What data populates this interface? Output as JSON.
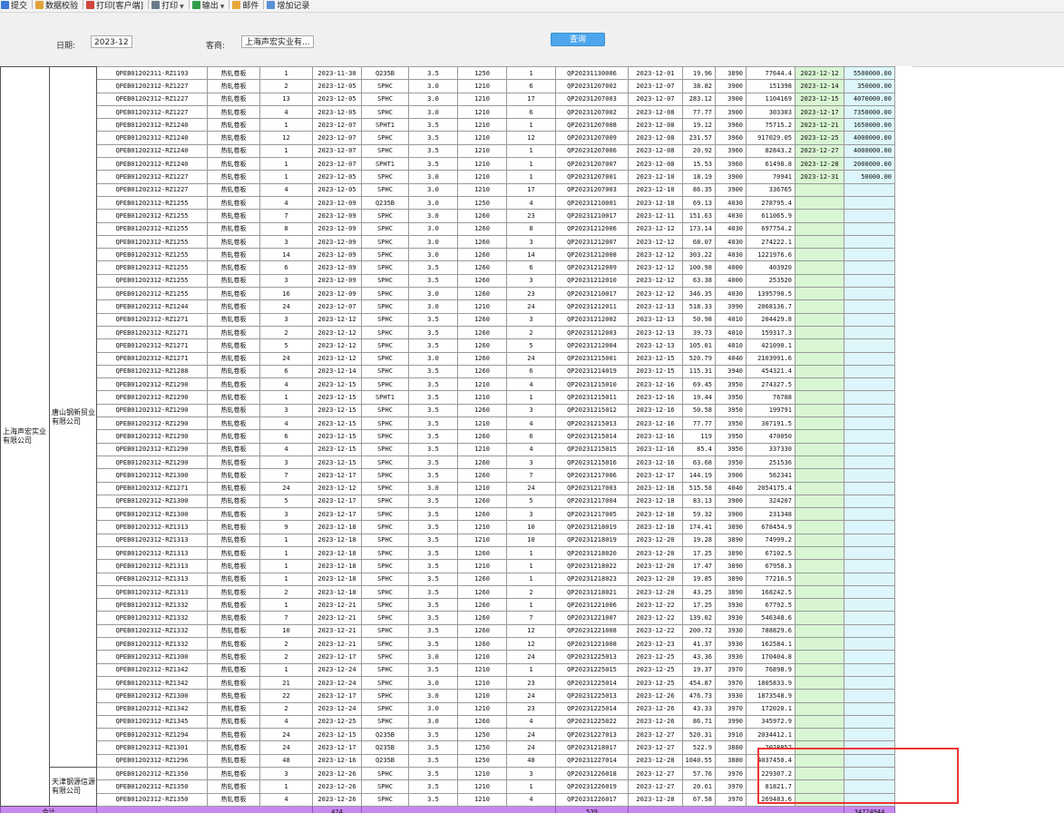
{
  "toolbar": {
    "items": [
      {
        "label": "提交",
        "icon": "submit-icon",
        "color": "#3a7ad6"
      },
      {
        "label": "数据校验",
        "icon": "validate-icon",
        "color": "#e2a33a"
      },
      {
        "label": "打印[客户端]",
        "icon": "print-client-icon",
        "color": "#d0453b"
      },
      {
        "label": "打印",
        "icon": "print-icon",
        "color": "#6b7a8a",
        "dropdown": true
      },
      {
        "label": "输出",
        "icon": "export-icon",
        "color": "#2f9e4a",
        "dropdown": true
      },
      {
        "label": "邮件",
        "icon": "mail-icon",
        "color": "#e6a73a"
      },
      {
        "label": "增加记录",
        "icon": "add-record-icon",
        "color": "#5a8fd6"
      }
    ]
  },
  "filter": {
    "date_label": "日期:",
    "date_value": "2023-12",
    "customer_label": "客商:",
    "customer_value": "上海声宏实业有...",
    "query_label": "查询"
  },
  "group": {
    "outer": "上海声宏实业有限公司",
    "inner1": "唐山钢新贸业有限公司",
    "inner2": "天津钢源信源有限公司"
  },
  "colors": {
    "green": "#d9f5d3",
    "blue": "#dcf6fb",
    "total": "#c987f1",
    "highlight": "#e33"
  },
  "rows": [
    [
      "QPEB01202311-RZ1193",
      "热轧卷板",
      "1",
      "2023-11-30",
      "Q235B",
      "3.5",
      "1250",
      "1",
      "QP20231130006",
      "2023-12-01",
      "19.96",
      "3890",
      "77644.4",
      "2023-12-12",
      "5500000.00"
    ],
    [
      "QPEB01202312-RZ1227",
      "热轧卷板",
      "2",
      "2023-12-05",
      "SPHC",
      "3.0",
      "1210",
      "6",
      "QP20231207002",
      "2023-12-07",
      "38.82",
      "3900",
      "151398",
      "2023-12-14",
      "350000.00"
    ],
    [
      "QPEB01202312-RZ1227",
      "热轧卷板",
      "13",
      "2023-12-05",
      "SPHC",
      "3.0",
      "1210",
      "17",
      "QP20231207003",
      "2023-12-07",
      "283.12",
      "3900",
      "1104169",
      "2023-12-15",
      "4070000.00"
    ],
    [
      "QPEB01202312-RZ1227",
      "热轧卷板",
      "4",
      "2023-12-05",
      "SPHC",
      "3.0",
      "1210",
      "6",
      "QP20231207002",
      "2023-12-08",
      "77.77",
      "3900",
      "303303",
      "2023-12-17",
      "7350000.00"
    ],
    [
      "QPEB01202312-RZ1240",
      "热轧卷板",
      "1",
      "2023-12-07",
      "SPHT1",
      "3.5",
      "1210",
      "1",
      "QP20231207008",
      "2023-12-08",
      "19.12",
      "3960",
      "75715.2",
      "2023-12-21",
      "1650000.00"
    ],
    [
      "QPEB01202312-RZ1240",
      "热轧卷板",
      "12",
      "2023-12-07",
      "SPHC",
      "3.5",
      "1210",
      "12",
      "QP20231207009",
      "2023-12-08",
      "231.57",
      "3960",
      "917029.05",
      "2023-12-25",
      "4000000.00"
    ],
    [
      "QPEB01202312-RZ1240",
      "热轧卷板",
      "1",
      "2023-12-07",
      "SPHC",
      "3.5",
      "1210",
      "1",
      "QP20231207006",
      "2023-12-08",
      "20.92",
      "3960",
      "82843.2",
      "2023-12-27",
      "4000000.00"
    ],
    [
      "QPEB01202312-RZ1240",
      "热轧卷板",
      "1",
      "2023-12-07",
      "SPHT1",
      "3.5",
      "1210",
      "1",
      "QP20231207007",
      "2023-12-08",
      "15.53",
      "3960",
      "61498.8",
      "2023-12-28",
      "2000000.00"
    ],
    [
      "QPEB01202312-RZ1227",
      "热轧卷板",
      "1",
      "2023-12-05",
      "SPHC",
      "3.0",
      "1210",
      "1",
      "QP20231207001",
      "2023-12-10",
      "18.19",
      "3900",
      "70941",
      "2023-12-31",
      "50000.00"
    ],
    [
      "QPEB01202312-RZ1227",
      "热轧卷板",
      "4",
      "2023-12-05",
      "SPHC",
      "3.0",
      "1210",
      "17",
      "QP20231207003",
      "2023-12-10",
      "86.35",
      "3900",
      "336765",
      "",
      ""
    ],
    [
      "QPEB01202312-RZ1255",
      "热轧卷板",
      "4",
      "2023-12-09",
      "Q235B",
      "3.0",
      "1250",
      "4",
      "QP20231210001",
      "2023-12-10",
      "69.13",
      "4030",
      "278795.4",
      "",
      ""
    ],
    [
      "QPEB01202312-RZ1255",
      "热轧卷板",
      "7",
      "2023-12-09",
      "SPHC",
      "3.0",
      "1260",
      "23",
      "QP20231210017",
      "2023-12-11",
      "151.63",
      "4030",
      "611065.9",
      "",
      ""
    ],
    [
      "QPEB01202312-RZ1255",
      "热轧卷板",
      "8",
      "2023-12-09",
      "SPHC",
      "3.0",
      "1260",
      "8",
      "QP20231212006",
      "2023-12-12",
      "173.14",
      "4030",
      "697754.2",
      "",
      ""
    ],
    [
      "QPEB01202312-RZ1255",
      "热轧卷板",
      "3",
      "2023-12-09",
      "SPHC",
      "3.0",
      "1260",
      "3",
      "QP20231212007",
      "2023-12-12",
      "68.07",
      "4030",
      "274222.1",
      "",
      ""
    ],
    [
      "QPEB01202312-RZ1255",
      "热轧卷板",
      "14",
      "2023-12-09",
      "SPHC",
      "3.0",
      "1260",
      "14",
      "QP20231212008",
      "2023-12-12",
      "303.22",
      "4030",
      "1221976.6",
      "",
      ""
    ],
    [
      "QPEB01202312-RZ1255",
      "热轧卷板",
      "6",
      "2023-12-09",
      "SPHC",
      "3.5",
      "1260",
      "6",
      "QP20231212009",
      "2023-12-12",
      "100.98",
      "4000",
      "403920",
      "",
      ""
    ],
    [
      "QPEB01202312-RZ1255",
      "热轧卷板",
      "3",
      "2023-12-09",
      "SPHC",
      "3.5",
      "1260",
      "3",
      "QP20231212010",
      "2023-12-12",
      "63.38",
      "4000",
      "253520",
      "",
      ""
    ],
    [
      "QPEB01202312-RZ1255",
      "热轧卷板",
      "16",
      "2023-12-09",
      "SPHC",
      "3.0",
      "1260",
      "23",
      "QP20231210017",
      "2023-12-12",
      "346.35",
      "4030",
      "1395790.5",
      "",
      ""
    ],
    [
      "QPEB01202312-RZ1244",
      "热轧卷板",
      "24",
      "2023-12-07",
      "SPHC",
      "3.0",
      "1210",
      "24",
      "QP20231212011",
      "2023-12-13",
      "518.33",
      "3990",
      "2068136.7",
      "",
      ""
    ],
    [
      "QPEB01202312-RZ1271",
      "热轧卷板",
      "3",
      "2023-12-12",
      "SPHC",
      "3.5",
      "1260",
      "3",
      "QP20231212002",
      "2023-12-13",
      "50.98",
      "4010",
      "204429.8",
      "",
      ""
    ],
    [
      "QPEB01202312-RZ1271",
      "热轧卷板",
      "2",
      "2023-12-12",
      "SPHC",
      "3.5",
      "1260",
      "2",
      "QP20231212003",
      "2023-12-13",
      "39.73",
      "4010",
      "159317.3",
      "",
      ""
    ],
    [
      "QPEB01202312-RZ1271",
      "热轧卷板",
      "5",
      "2023-12-12",
      "SPHC",
      "3.5",
      "1260",
      "5",
      "QP20231212004",
      "2023-12-13",
      "105.01",
      "4010",
      "421090.1",
      "",
      ""
    ],
    [
      "QPEB01202312-RZ1271",
      "热轧卷板",
      "24",
      "2023-12-12",
      "SPHC",
      "3.0",
      "1260",
      "24",
      "QP20231215001",
      "2023-12-15",
      "520.79",
      "4040",
      "2103991.6",
      "",
      ""
    ],
    [
      "QPEB01202312-RZ1288",
      "热轧卷板",
      "6",
      "2023-12-14",
      "SPHC",
      "3.5",
      "1260",
      "6",
      "QP20231214019",
      "2023-12-15",
      "115.31",
      "3940",
      "454321.4",
      "",
      ""
    ],
    [
      "QPEB01202312-RZ1290",
      "热轧卷板",
      "4",
      "2023-12-15",
      "SPHC",
      "3.5",
      "1210",
      "4",
      "QP20231215010",
      "2023-12-16",
      "69.45",
      "3950",
      "274327.5",
      "",
      ""
    ],
    [
      "QPEB01202312-RZ1290",
      "热轧卷板",
      "1",
      "2023-12-15",
      "SPHT1",
      "3.5",
      "1210",
      "1",
      "QP20231215011",
      "2023-12-16",
      "19.44",
      "3950",
      "76788",
      "",
      ""
    ],
    [
      "QPEB01202312-RZ1290",
      "热轧卷板",
      "3",
      "2023-12-15",
      "SPHC",
      "3.5",
      "1260",
      "3",
      "QP20231215012",
      "2023-12-16",
      "50.58",
      "3950",
      "199791",
      "",
      ""
    ],
    [
      "QPEB01202312-RZ1290",
      "热轧卷板",
      "4",
      "2023-12-15",
      "SPHC",
      "3.5",
      "1210",
      "4",
      "QP20231215013",
      "2023-12-16",
      "77.77",
      "3950",
      "307191.5",
      "",
      ""
    ],
    [
      "QPEB01202312-RZ1290",
      "热轧卷板",
      "6",
      "2023-12-15",
      "SPHC",
      "3.5",
      "1260",
      "6",
      "QP20231215014",
      "2023-12-16",
      "119",
      "3950",
      "470050",
      "",
      ""
    ],
    [
      "QPEB01202312-RZ1290",
      "热轧卷板",
      "4",
      "2023-12-15",
      "SPHC",
      "3.5",
      "1210",
      "4",
      "QP20231215015",
      "2023-12-16",
      "85.4",
      "3950",
      "337330",
      "",
      ""
    ],
    [
      "QPEB01202312-RZ1290",
      "热轧卷板",
      "3",
      "2023-12-15",
      "SPHC",
      "3.5",
      "1260",
      "3",
      "QP20231215016",
      "2023-12-16",
      "63.68",
      "3950",
      "251536",
      "",
      ""
    ],
    [
      "QPEB01202312-RZ1300",
      "热轧卷板",
      "7",
      "2023-12-17",
      "SPHC",
      "3.5",
      "1260",
      "7",
      "QP20231217006",
      "2023-12-17",
      "144.19",
      "3900",
      "562341",
      "",
      ""
    ],
    [
      "QPEB01202312-RZ1271",
      "热轧卷板",
      "24",
      "2023-12-12",
      "SPHC",
      "3.0",
      "1210",
      "24",
      "QP20231217003",
      "2023-12-18",
      "515.58",
      "4040",
      "2054175.4",
      "",
      ""
    ],
    [
      "QPEB01202312-RZ1300",
      "热轧卷板",
      "5",
      "2023-12-17",
      "SPHC",
      "3.5",
      "1260",
      "5",
      "QP20231217004",
      "2023-12-18",
      "83.13",
      "3900",
      "324207",
      "",
      ""
    ],
    [
      "QPEB01202312-RZ1300",
      "热轧卷板",
      "3",
      "2023-12-17",
      "SPHC",
      "3.5",
      "1260",
      "3",
      "QP20231217005",
      "2023-12-18",
      "59.32",
      "3900",
      "231348",
      "",
      ""
    ],
    [
      "QPEB01202312-RZ1313",
      "热轧卷板",
      "9",
      "2023-12-18",
      "SPHC",
      "3.5",
      "1210",
      "10",
      "QP20231218019",
      "2023-12-18",
      "174.41",
      "3890",
      "678454.9",
      "",
      ""
    ],
    [
      "QPEB01202312-RZ1313",
      "热轧卷板",
      "1",
      "2023-12-18",
      "SPHC",
      "3.5",
      "1210",
      "10",
      "QP20231218019",
      "2023-12-20",
      "19.28",
      "3890",
      "74999.2",
      "",
      ""
    ],
    [
      "QPEB01202312-RZ1313",
      "热轧卷板",
      "1",
      "2023-12-18",
      "SPHC",
      "3.5",
      "1260",
      "1",
      "QP20231218020",
      "2023-12-20",
      "17.25",
      "3890",
      "67102.5",
      "",
      ""
    ],
    [
      "QPEB01202312-RZ1313",
      "热轧卷板",
      "1",
      "2023-12-18",
      "SPHC",
      "3.5",
      "1210",
      "1",
      "QP20231218022",
      "2023-12-20",
      "17.47",
      "3890",
      "67958.3",
      "",
      ""
    ],
    [
      "QPEB01202312-RZ1313",
      "热轧卷板",
      "1",
      "2023-12-18",
      "SPHC",
      "3.5",
      "1260",
      "1",
      "QP20231218023",
      "2023-12-20",
      "19.85",
      "3890",
      "77216.5",
      "",
      ""
    ],
    [
      "QPEB01202312-RZ1313",
      "热轧卷板",
      "2",
      "2023-12-18",
      "SPHC",
      "3.5",
      "1260",
      "2",
      "QP20231218021",
      "2023-12-20",
      "43.25",
      "3890",
      "168242.5",
      "",
      ""
    ],
    [
      "QPEB01202312-RZ1332",
      "热轧卷板",
      "1",
      "2023-12-21",
      "SPHC",
      "3.5",
      "1260",
      "1",
      "QP20231221006",
      "2023-12-22",
      "17.25",
      "3930",
      "67792.5",
      "",
      ""
    ],
    [
      "QPEB01202312-RZ1332",
      "热轧卷板",
      "7",
      "2023-12-21",
      "SPHC",
      "3.5",
      "1260",
      "7",
      "QP20231221007",
      "2023-12-22",
      "139.02",
      "3930",
      "546348.6",
      "",
      ""
    ],
    [
      "QPEB01202312-RZ1332",
      "热轧卷板",
      "10",
      "2023-12-21",
      "SPHC",
      "3.5",
      "1260",
      "12",
      "QP20231221008",
      "2023-12-22",
      "200.72",
      "3930",
      "788829.6",
      "",
      ""
    ],
    [
      "QPEB01202312-RZ1332",
      "热轧卷板",
      "2",
      "2023-12-21",
      "SPHC",
      "3.5",
      "1260",
      "12",
      "QP20231221008",
      "2023-12-23",
      "41.37",
      "3930",
      "162584.1",
      "",
      ""
    ],
    [
      "QPEB01202312-RZ1300",
      "热轧卷板",
      "2",
      "2023-12-17",
      "SPHC",
      "3.0",
      "1210",
      "24",
      "QP20231225013",
      "2023-12-25",
      "43.36",
      "3930",
      "170404.8",
      "",
      ""
    ],
    [
      "QPEB01202312-RZ1342",
      "热轧卷板",
      "1",
      "2023-12-24",
      "SPHC",
      "3.5",
      "1210",
      "1",
      "QP20231225015",
      "2023-12-25",
      "19.37",
      "3970",
      "76898.9",
      "",
      ""
    ],
    [
      "QPEB01202312-RZ1342",
      "热轧卷板",
      "21",
      "2023-12-24",
      "SPHC",
      "3.0",
      "1210",
      "23",
      "QP20231225014",
      "2023-12-25",
      "454.87",
      "3970",
      "1805833.9",
      "",
      ""
    ],
    [
      "QPEB01202312-RZ1300",
      "热轧卷板",
      "22",
      "2023-12-17",
      "SPHC",
      "3.0",
      "1210",
      "24",
      "QP20231225013",
      "2023-12-26",
      "476.73",
      "3930",
      "1873548.9",
      "",
      ""
    ],
    [
      "QPEB01202312-RZ1342",
      "热轧卷板",
      "2",
      "2023-12-24",
      "SPHC",
      "3.0",
      "1210",
      "23",
      "QP20231225014",
      "2023-12-26",
      "43.33",
      "3970",
      "172020.1",
      "",
      ""
    ],
    [
      "QPEB01202312-RZ1345",
      "热轧卷板",
      "4",
      "2023-12-25",
      "SPHC",
      "3.0",
      "1260",
      "4",
      "QP20231225022",
      "2023-12-26",
      "86.71",
      "3990",
      "345972.9",
      "",
      ""
    ],
    [
      "QPEB01202312-RZ1294",
      "热轧卷板",
      "24",
      "2023-12-15",
      "Q235B",
      "3.5",
      "1250",
      "24",
      "QP20231227013",
      "2023-12-27",
      "520.31",
      "3910",
      "2034412.1",
      "",
      ""
    ],
    [
      "QPEB01202312-RZ1301",
      "热轧卷板",
      "24",
      "2023-12-17",
      "Q235B",
      "3.5",
      "1250",
      "24",
      "QP20231218017",
      "2023-12-27",
      "522.9",
      "3880",
      "2028852",
      "",
      ""
    ],
    [
      "QPEB01202312-RZ1296",
      "热轧卷板",
      "48",
      "2023-12-16",
      "Q235B",
      "3.5",
      "1250",
      "48",
      "QP20231227014",
      "2023-12-28",
      "1040.55",
      "3880",
      "4037450.4",
      "",
      ""
    ],
    [
      "QPEB01202312-RZ1350",
      "热轧卷板",
      "3",
      "2023-12-26",
      "SPHC",
      "3.5",
      "1210",
      "3",
      "QP20231226018",
      "2023-12-27",
      "57.76",
      "3970",
      "229307.2",
      "",
      ""
    ],
    [
      "QPEB01202312-RZ1350",
      "热轧卷板",
      "1",
      "2023-12-26",
      "SPHC",
      "3.5",
      "1210",
      "1",
      "QP20231226019",
      "2023-12-27",
      "20.61",
      "3970",
      "81821.7",
      "",
      ""
    ],
    [
      "QPEB01202312-RZ1350",
      "热轧卷板",
      "4",
      "2023-12-26",
      "SPHC",
      "3.5",
      "1210",
      "4",
      "QP20231226017",
      "2023-12-28",
      "67.58",
      "3970",
      "269483.6",
      "",
      ""
    ]
  ],
  "total": {
    "label": "合计",
    "qty": "424",
    "count": "539",
    "amount": "34724944"
  }
}
